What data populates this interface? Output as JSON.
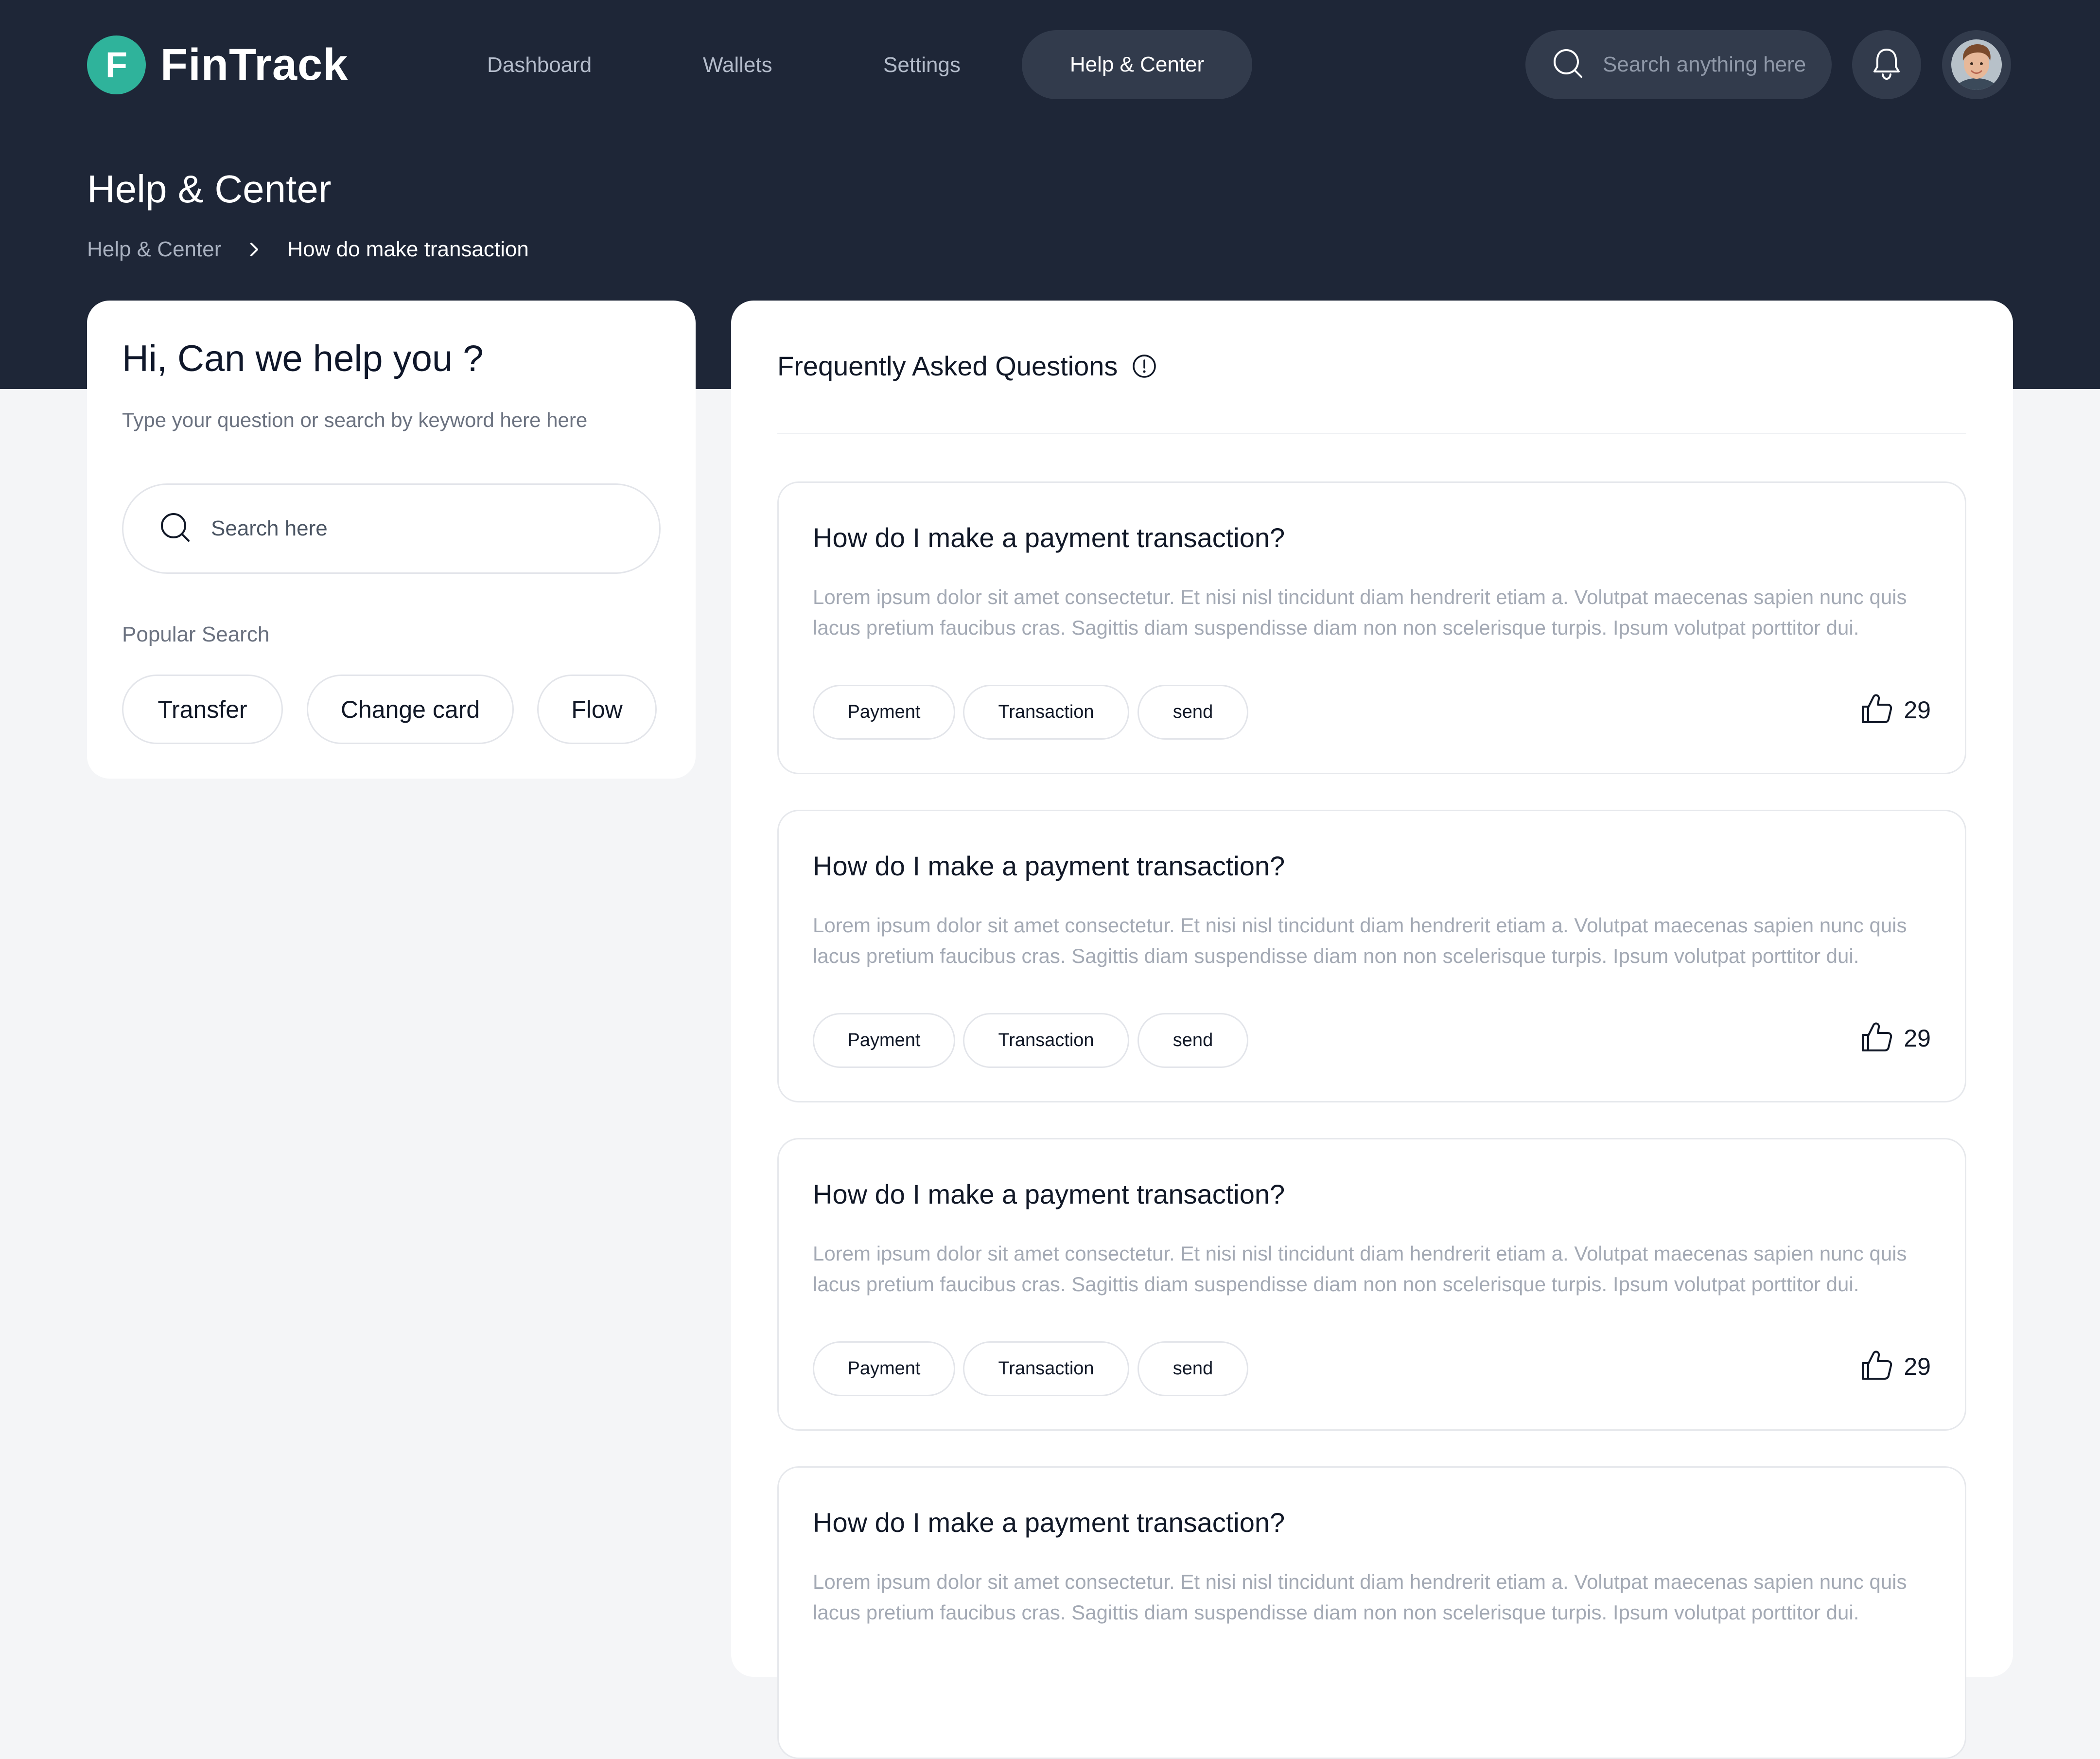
{
  "header": {
    "brand": {
      "logo_letter": "F",
      "name": "FinTrack",
      "accent_color": "#2fb39b"
    },
    "nav": [
      {
        "label": "Dashboard"
      },
      {
        "label": "Wallets"
      },
      {
        "label": "Settings"
      },
      {
        "label": "Help & Center",
        "active": true
      }
    ],
    "search": {
      "placeholder": "Search anything here",
      "icon": "search-icon"
    },
    "notifications_icon": "bell-icon",
    "avatar_icon": "user-avatar",
    "background_color": "#1e2637"
  },
  "page": {
    "title": "Help & Center",
    "breadcrumb": {
      "parent": "Help & Center",
      "current": "How do make transaction",
      "separator_icon": "chevron-right-icon"
    }
  },
  "help_card": {
    "title": "Hi, Can we help you ?",
    "subtitle": "Type your question or search by keyword here here",
    "search_placeholder": "Search here",
    "popular_label": "Popular Search",
    "popular": [
      "Transfer",
      "Change card",
      "Flow"
    ]
  },
  "faq": {
    "title": "Frequently Asked Questions",
    "info_icon": "info-icon",
    "items": [
      {
        "question": "How do I make a payment transaction?",
        "answer": "Lorem ipsum dolor sit amet consectetur. Et nisi nisl tincidunt diam hendrerit etiam a. Volutpat maecenas sapien nunc quis lacus pretium faucibus cras. Sagittis diam suspendisse diam non non scelerisque turpis. Ipsum volutpat porttitor dui.",
        "tags": [
          "Payment",
          "Transaction",
          "send"
        ],
        "likes": "29"
      },
      {
        "question": "How do I make a payment transaction?",
        "answer": "Lorem ipsum dolor sit amet consectetur. Et nisi nisl tincidunt diam hendrerit etiam a. Volutpat maecenas sapien nunc quis lacus pretium faucibus cras. Sagittis diam suspendisse diam non non scelerisque turpis. Ipsum volutpat porttitor dui.",
        "tags": [
          "Payment",
          "Transaction",
          "send"
        ],
        "likes": "29"
      },
      {
        "question": "How do I make a payment transaction?",
        "answer": "Lorem ipsum dolor sit amet consectetur. Et nisi nisl tincidunt diam hendrerit etiam a. Volutpat maecenas sapien nunc quis lacus pretium faucibus cras. Sagittis diam suspendisse diam non non scelerisque turpis. Ipsum volutpat porttitor dui.",
        "tags": [
          "Payment",
          "Transaction",
          "send"
        ],
        "likes": "29"
      },
      {
        "question": "How do I make a payment transaction?",
        "answer": "Lorem ipsum dolor sit amet consectetur. Et nisi nisl tincidunt diam hendrerit etiam a. Volutpat maecenas sapien nunc quis lacus pretium faucibus cras. Sagittis diam suspendisse diam non non scelerisque turpis. Ipsum volutpat porttitor dui."
      }
    ]
  }
}
